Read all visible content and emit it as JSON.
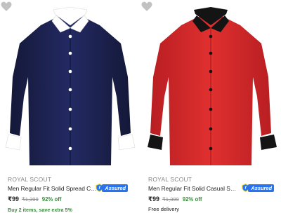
{
  "products": [
    {
      "brand": "ROYAL SCOUT",
      "title": "Men Regular Fit Solid Spread Coll...",
      "assured": "Assured",
      "price": "₹99",
      "mrp": "₹1,399",
      "discount": "92% off",
      "offer": "Buy 2 items, save extra 5%",
      "shirt_color": "#1b2150",
      "accent_color": "#ffffff",
      "icons": [
        "heart-icon",
        "shield-icon"
      ]
    },
    {
      "brand": "ROYAL SCOUT",
      "title": "Men Regular Fit Solid Casual Shirt",
      "assured": "Assured",
      "price": "₹99",
      "mrp": "₹1,399",
      "discount": "92% off",
      "delivery": "Free delivery",
      "shirt_color": "#d8282d",
      "accent_color": "#111111",
      "icons": [
        "heart-icon",
        "shield-icon"
      ]
    }
  ],
  "colors": {
    "assured_blue": "#2874f0",
    "discount_green": "#388e3c",
    "muted_gray": "#878787"
  }
}
